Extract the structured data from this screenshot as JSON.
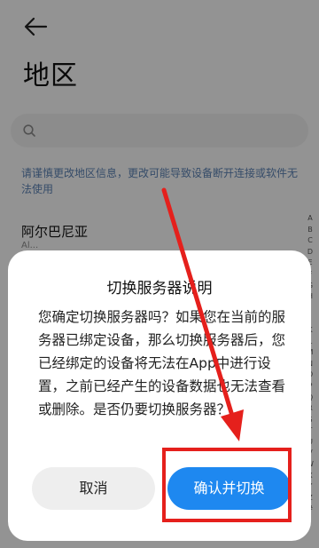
{
  "header": {
    "title": "地区"
  },
  "search": {
    "placeholder": ""
  },
  "notice": {
    "text": "请谨慎更改地区信息，更改可能导致设备断开连接或软件无法使用"
  },
  "list": {
    "first_item": {
      "name": "阿尔巴尼亚",
      "sub": "Al..."
    }
  },
  "alphabet_index": [
    "A",
    "B",
    "C",
    "D",
    "E",
    "F",
    "G",
    "H",
    "I",
    "J",
    "K",
    "L",
    "M",
    "N",
    "O",
    "P",
    "Q",
    "R",
    "S",
    "T",
    "U",
    "V",
    "W",
    "X",
    "Y",
    "Z",
    "#"
  ],
  "dialog": {
    "title": "切换服务器说明",
    "body": "您确定切换服务器吗？如果您在当前的服务器已绑定设备，那么切换服务器后，您已经绑定的设备将无法在App中进行设置，之前已经产生的设备数据也无法查看或删除。是否仍要切换服务器？",
    "cancel_label": "取消",
    "confirm_label": "确认并切换"
  },
  "colors": {
    "accent": "#1e88f0",
    "annotation_red": "#e5201c",
    "notice_text": "#5a7fb0"
  },
  "icons": {
    "back": "arrow-left-icon",
    "search": "search-icon"
  }
}
